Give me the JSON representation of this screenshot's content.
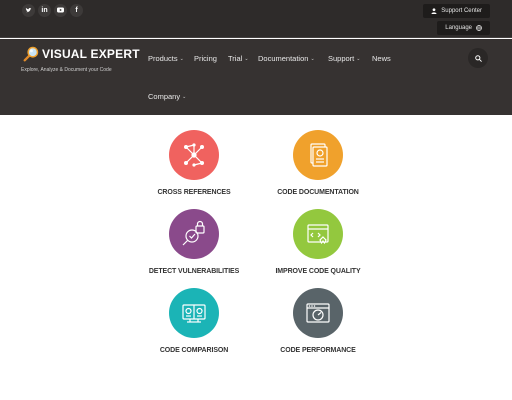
{
  "topbar": {
    "social": [
      {
        "name": "twitter-icon",
        "glyph": ""
      },
      {
        "name": "linkedin-icon",
        "glyph": "in"
      },
      {
        "name": "youtube-icon",
        "glyph": ""
      },
      {
        "name": "facebook-icon",
        "glyph": "f"
      }
    ],
    "support_label": "Support Center",
    "language_label": "Language"
  },
  "brand": {
    "name": "VISUAL EXPERT",
    "tagline": "Explore, Analyze & Document your Code"
  },
  "nav": {
    "items": [
      {
        "label": "Products",
        "dropdown": true
      },
      {
        "label": "Pricing",
        "dropdown": false
      },
      {
        "label": "Trial",
        "dropdown": true
      },
      {
        "label": "Documentation",
        "dropdown": true
      },
      {
        "label": "Support",
        "dropdown": true
      },
      {
        "label": "News",
        "dropdown": false
      },
      {
        "label": "Company",
        "dropdown": true
      }
    ]
  },
  "features": [
    {
      "label": "CROSS REFERENCES",
      "color": "#f0625f",
      "icon": "network-icon"
    },
    {
      "label": "CODE DOCUMENTATION",
      "color": "#f0a12c",
      "icon": "document-icon"
    },
    {
      "label": "DETECT VULNERABILITIES",
      "color": "#8a4a8b",
      "icon": "lock-icon"
    },
    {
      "label": "IMPROVE CODE QUALITY",
      "color": "#93c83e",
      "icon": "code-window-icon"
    },
    {
      "label": "CODE COMPARISON",
      "color": "#1bb4b6",
      "icon": "compare-icon"
    },
    {
      "label": "CODE PERFORMANCE",
      "color": "#596469",
      "icon": "speedometer-icon"
    }
  ]
}
